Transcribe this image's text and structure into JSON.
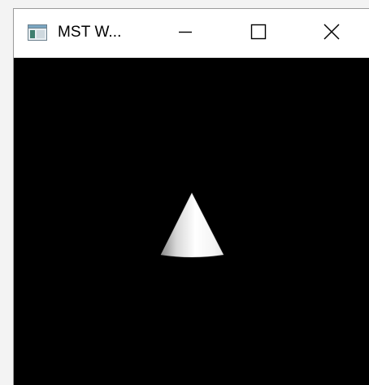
{
  "window": {
    "title": "MST W...",
    "icon": "app-window-icon",
    "controls": {
      "minimize_icon": "minimize-icon",
      "maximize_icon": "maximize-icon",
      "close_icon": "close-icon"
    }
  },
  "viewport": {
    "background_color": "#000000",
    "object": "cone",
    "object_color": "#ffffff"
  }
}
